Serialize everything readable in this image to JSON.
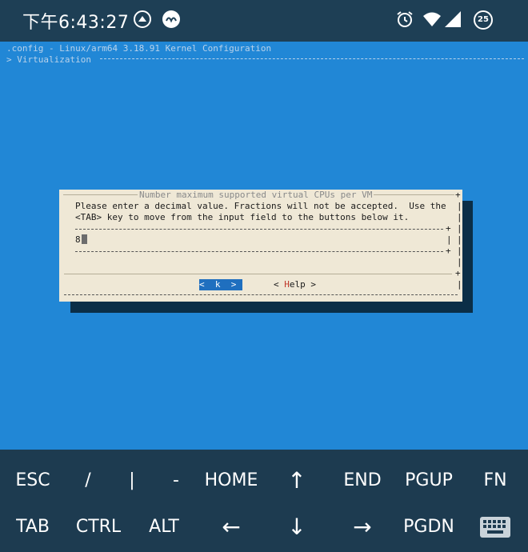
{
  "status_bar": {
    "time": "下午6:43:27",
    "icons": [
      "app-icon-1",
      "app-icon-2",
      "alarm-icon",
      "wifi-icon",
      "signal-icon"
    ],
    "badge": "25"
  },
  "terminal": {
    "header_line": ".config - Linux/arm64 3.18.91 Kernel Configuration",
    "breadcrumb": "> Virtualization",
    "dialog": {
      "title": "Number maximum supported virtual CPUs per VM",
      "text_line_1": "Please enter a decimal value. Fractions will not be accepted.  Use the",
      "text_line_2": "<TAB> key to move from the input field to the buttons below it.",
      "input_value": "8",
      "ok_button": "<  k  >",
      "help_prefix": "< ",
      "help_hotkey": "H",
      "help_rest": "elp >"
    }
  },
  "extra_keys": {
    "row1": [
      "ESC",
      "/",
      "|",
      "-",
      "HOME",
      "↑",
      "END",
      "PGUP",
      "FN"
    ],
    "row2": [
      "TAB",
      "CTRL",
      "ALT",
      "←",
      "↓",
      "→",
      "PGDN",
      "keyboard-icon"
    ]
  },
  "colors": {
    "terminal_bg": "#2187d6",
    "dialog_bg": "#efe8d6",
    "keys_bg": "#1d3b50",
    "statusbar_bg": "#1e3f55",
    "selected_button_bg": "#1f6fbf"
  }
}
